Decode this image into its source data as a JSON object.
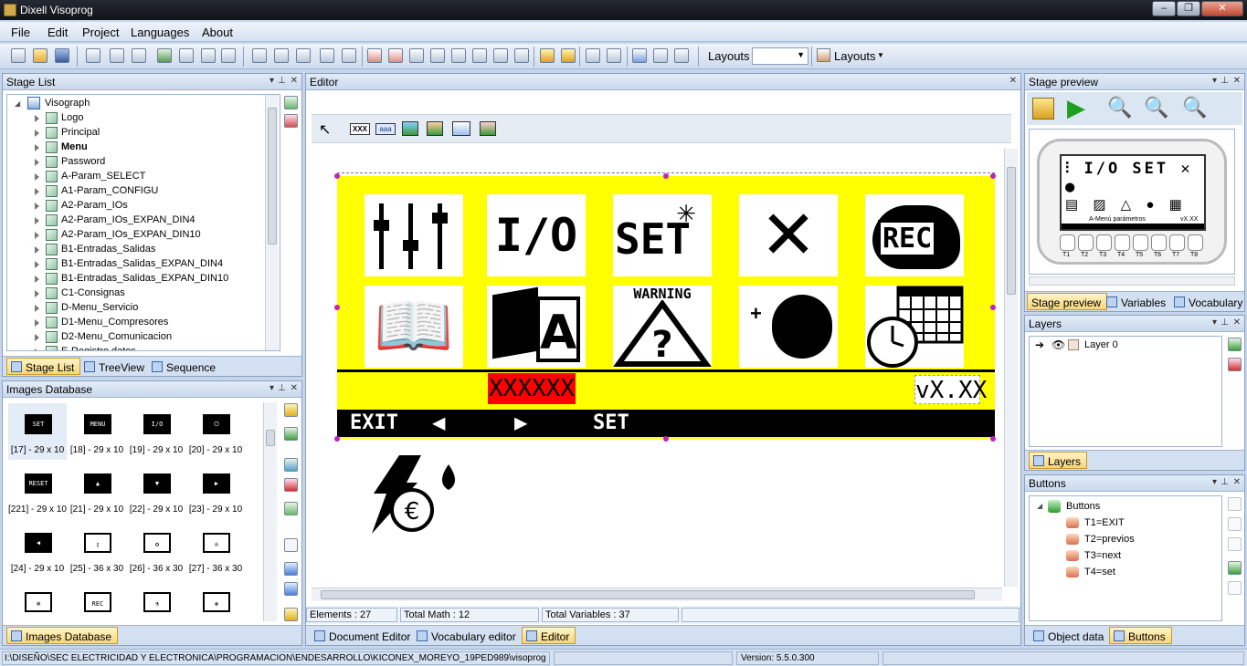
{
  "window": {
    "title": "Dixell Visoprog",
    "min": "0",
    "max": "1",
    "close": "r"
  },
  "menu": [
    "File",
    "Edit",
    "Project",
    "Languages",
    "About"
  ],
  "toolbar": {
    "layouts_label": "Layouts",
    "layouts_value": "",
    "layouts_button": "Layouts"
  },
  "stage_list": {
    "title": "Stage List",
    "root": "Visograph",
    "items": [
      "Logo",
      "Principal",
      "Menu",
      "Password",
      "A-Param_SELECT",
      "A1-Param_CONFIGU",
      "A2-Param_IOs",
      "A2-Param_IOs_EXPAN_DIN4",
      "A2-Param_IOs_EXPAN_DIN10",
      "B1-Entradas_Salidas",
      "B1-Entradas_Salidas_EXPAN_DIN4",
      "B1-Entradas_Salidas_EXPAN_DIN10",
      "C1-Consignas",
      "D-Menu_Servicio",
      "D1-Menu_Compresores",
      "D2-Menu_Comunicacion",
      "E-Registro datos"
    ],
    "bold_item": "Menu",
    "tabs": [
      "Stage List",
      "TreeView",
      "Sequence"
    ]
  },
  "images_db": {
    "title": "Images Database",
    "items": [
      {
        "thumb": "SET",
        "caption": "[17] - 29 x 10"
      },
      {
        "thumb": "MENU",
        "caption": "[18] - 29 x 10"
      },
      {
        "thumb": "I/O",
        "caption": "[19] - 29 x 10"
      },
      {
        "thumb": "⏻",
        "caption": "[20] - 29 x 10"
      },
      {
        "thumb": "RESET",
        "caption": "[221] - 29 x 10"
      },
      {
        "thumb": "▲",
        "caption": "[21] - 29 x 10"
      },
      {
        "thumb": "▼",
        "caption": "[22] - 29 x 10"
      },
      {
        "thumb": "▶",
        "caption": "[23] - 29 x 10"
      },
      {
        "thumb": "◀",
        "caption": "[24] - 29 x 10"
      },
      {
        "thumb": "▯",
        "caption": "[25] - 36 x 30"
      },
      {
        "thumb": "⚙",
        "caption": "[26] - 36 x 30"
      },
      {
        "thumb": "✇",
        "caption": "[27] - 36 x 30"
      },
      {
        "thumb": "❄",
        "caption": ""
      },
      {
        "thumb": "REC",
        "caption": ""
      },
      {
        "thumb": "⚗",
        "caption": ""
      },
      {
        "thumb": "❅",
        "caption": ""
      }
    ],
    "tab": "Images Database"
  },
  "editor": {
    "title": "Editor",
    "tools": [
      "XXX",
      "aaa"
    ],
    "screen": {
      "row1": [
        "sliders-icon",
        "io-icon",
        "set-icon",
        "tools-icon",
        "rec-icon"
      ],
      "row1_text": [
        "",
        "I/O",
        "SET",
        "",
        "REC"
      ],
      "row2_text": [
        "",
        "",
        "WARNING",
        "",
        ""
      ],
      "value_field": "XXXXXX",
      "version": "vX.XX",
      "bar": [
        "EXIT",
        "◀",
        "▶",
        "SET"
      ]
    },
    "status": {
      "elements": "Elements : 27",
      "math": "Total Math :  12",
      "variables": "Total Variables : 37"
    },
    "tabs": [
      "Document Editor",
      "Vocabulary editor",
      "Editor"
    ]
  },
  "stage_preview": {
    "title": "Stage preview",
    "lcd_caption": "A-Menú parámetros",
    "lcd_version": "vX.XX",
    "key_labels": [
      "T1",
      "T2",
      "T3",
      "T4",
      "T5",
      "T6",
      "T7",
      "T8"
    ],
    "tabs": [
      "Stage preview",
      "Variables",
      "Vocabulary"
    ]
  },
  "layers": {
    "title": "Layers",
    "items": [
      "Layer 0"
    ],
    "tab": "Layers"
  },
  "buttons": {
    "title": "Buttons",
    "root": "Buttons",
    "items": [
      "T1=EXIT",
      "T2=previos",
      "T3=next",
      "T4=set"
    ],
    "tabs": [
      "Object data",
      "Buttons"
    ]
  },
  "statusbar": {
    "path": "I:\\DISEÑO\\SEC ELECTRICIDAD Y ELECTRONICA\\PROGRAMACION\\ENDESARROLLO\\KICONEX_MOREYO_19PED989\\visoprog",
    "version": "Version: 5.5.0.300"
  },
  "colors": {
    "accent": "#ffff00",
    "value_bg": "#ff0000",
    "frame": "#c5d6ec",
    "tab_active": "#f6d67a"
  }
}
